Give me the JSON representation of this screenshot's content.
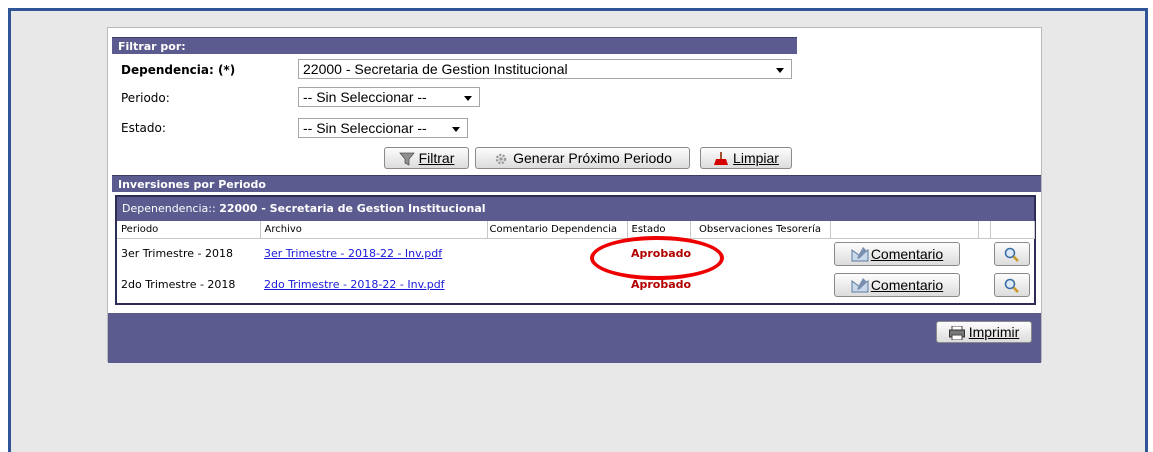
{
  "filter": {
    "header": "Filtrar por:",
    "dependencia_label": "Dependencia: (*)",
    "dependencia_value": "22000 - Secretaria de Gestion Institucional",
    "periodo_label": "Periodo:",
    "periodo_value": "-- Sin Seleccionar --",
    "estado_label": "Estado:",
    "estado_value": "-- Sin Seleccionar --",
    "btn_filtrar": "Filtrar",
    "btn_generar": "Generar Próximo Periodo",
    "btn_limpiar": "Limpiar"
  },
  "inversiones": {
    "header": "Inversiones por Periodo",
    "dep_prefix": "Depenendencia:: ",
    "dep_value": "22000 - Secretaria de Gestion Institucional",
    "columns": [
      "Periodo",
      "Archivo",
      "Comentario Dependencia",
      "Estado",
      "Observaciones Tesorería"
    ],
    "rows": [
      {
        "periodo": "3er Trimestre - 2018",
        "archivo": "3er Trimestre - 2018-22 - Inv.pdf",
        "comentario": "",
        "estado": "Aprobado",
        "observaciones": "",
        "btn_comentario": "Comentario"
      },
      {
        "periodo": "2do Trimestre - 2018",
        "archivo": "2do Trimestre - 2018-22 - Inv.pdf",
        "comentario": "",
        "estado": "Aprobado",
        "observaciones": "",
        "btn_comentario": "Comentario"
      }
    ]
  },
  "footer": {
    "btn_imprimir": "Imprimir"
  },
  "colors": {
    "header_bg": "#5b5b8f",
    "status_approved": "#b00000",
    "link": "#1a1adb",
    "highlight": "#ee0000"
  },
  "icons": [
    "funnel-icon",
    "gear-icon",
    "broom-icon",
    "comment-icon",
    "magnifier-icon",
    "printer-icon"
  ]
}
